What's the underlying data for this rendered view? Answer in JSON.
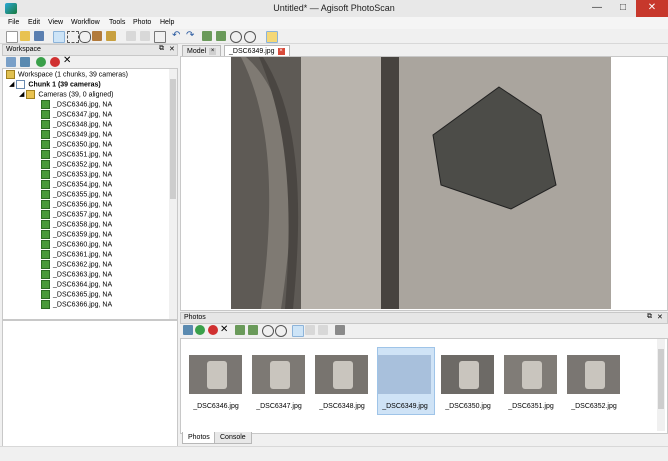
{
  "window": {
    "title": "Untitled* — Agisoft PhotoScan",
    "min": "—",
    "max": "□",
    "close": "✕"
  },
  "menu": [
    "File",
    "Edit",
    "View",
    "Workflow",
    "Tools",
    "Photo",
    "Help"
  ],
  "workspace": {
    "title": "Workspace",
    "root": "Workspace (1 chunks, 39 cameras)",
    "chunk": "Chunk 1 (39 cameras)",
    "cameras": "Cameras (39, 0 aligned)",
    "items": [
      "_DSC6346.jpg, NA",
      "_DSC6347.jpg, NA",
      "_DSC6348.jpg, NA",
      "_DSC6349.jpg, NA",
      "_DSC6350.jpg, NA",
      "_DSC6351.jpg, NA",
      "_DSC6352.jpg, NA",
      "_DSC6353.jpg, NA",
      "_DSC6354.jpg, NA",
      "_DSC6355.jpg, NA",
      "_DSC6356.jpg, NA",
      "_DSC6357.jpg, NA",
      "_DSC6358.jpg, NA",
      "_DSC6359.jpg, NA",
      "_DSC6360.jpg, NA",
      "_DSC6361.jpg, NA",
      "_DSC6362.jpg, NA",
      "_DSC6363.jpg, NA",
      "_DSC6364.jpg, NA",
      "_DSC6365.jpg, NA",
      "_DSC6366.jpg, NA"
    ]
  },
  "tabs": {
    "model": "Model",
    "photo": "_DSC6349.jpg"
  },
  "photos": {
    "title": "Photos",
    "thumbs": [
      "_DSC6346.jpg",
      "_DSC6347.jpg",
      "_DSC6348.jpg",
      "_DSC6349.jpg",
      "_DSC6350.jpg",
      "_DSC6351.jpg",
      "_DSC6352.jpg"
    ],
    "selected_index": 3
  },
  "bottom_tabs": [
    "Photos",
    "Console"
  ],
  "panel_buttons": {
    "float": "⧉",
    "close": "✕"
  }
}
